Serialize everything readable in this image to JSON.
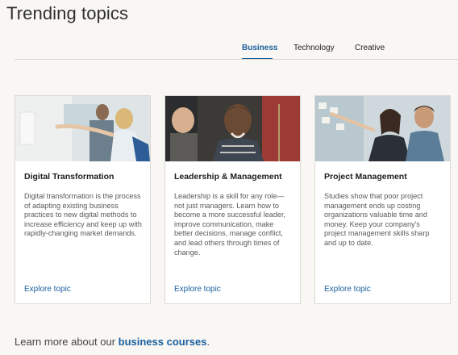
{
  "header": {
    "title": "Trending topics"
  },
  "tabs": [
    {
      "label": "Business",
      "active": true
    },
    {
      "label": "Technology",
      "active": false
    },
    {
      "label": "Creative",
      "active": false
    }
  ],
  "cards": [
    {
      "title": "Digital Transformation",
      "body": "Digital transformation is the process of adapting existing business practices to new digital methods to increase efficiency and keep up with rapidly-changing market demands.",
      "link": "Explore topic"
    },
    {
      "title": "Leadership & Management",
      "body": "Leadership is a skill for any role—not just managers. Learn how to become a more successful leader, improve communication, make better decisions, manage conflict, and lead others through times of change.",
      "link": "Explore topic"
    },
    {
      "title": "Project Management",
      "body": "Studies show that poor project management ends up costing organizations valuable time and money. Keep your company's project management skills sharp and up to date.",
      "link": "Explore topic"
    }
  ],
  "footer": {
    "text": "Learn more about our ",
    "link": "business courses",
    "suffix": "."
  },
  "colors": {
    "accent": "#1a5f9e",
    "background": "#f9f7f4"
  }
}
